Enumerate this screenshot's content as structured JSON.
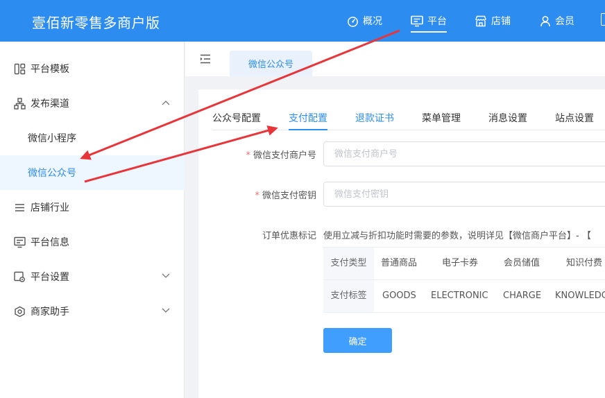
{
  "header": {
    "brand": "壹佰新零售多商户版",
    "nav": [
      {
        "label": "概况",
        "icon": "dashboard-icon"
      },
      {
        "label": "平台",
        "icon": "monitor-icon",
        "active": true
      },
      {
        "label": "店铺",
        "icon": "store-icon"
      },
      {
        "label": "会员",
        "icon": "user-icon"
      }
    ]
  },
  "sidebar": {
    "items": [
      {
        "label": "平台模板",
        "icon": "template-icon"
      },
      {
        "label": "发布渠道",
        "icon": "channel-icon",
        "expanded": true
      },
      {
        "label": "微信小程序"
      },
      {
        "label": "微信公众号",
        "selected": true
      },
      {
        "label": "店铺行业",
        "icon": "list-icon"
      },
      {
        "label": "平台信息",
        "icon": "monitor-icon"
      },
      {
        "label": "平台设置",
        "icon": "settings-icon"
      },
      {
        "label": "商家助手",
        "icon": "helper-icon"
      }
    ]
  },
  "page_tab": {
    "label": "微信公众号"
  },
  "tabs": [
    {
      "label": "公众号配置"
    },
    {
      "label": "支付配置",
      "active": true
    },
    {
      "label": "退款证书",
      "link": true
    },
    {
      "label": "菜单管理"
    },
    {
      "label": "消息设置"
    },
    {
      "label": "站点设置"
    }
  ],
  "form": {
    "merchant_id": {
      "label": "微信支付商户号",
      "placeholder": "微信支付商户号",
      "required": "*"
    },
    "pay_key": {
      "label": "微信支付密钥",
      "placeholder": "微信支付密钥",
      "required": "*"
    },
    "discount_tag": {
      "label": "订单优惠标记",
      "hint": "使用立减与折扣功能时需要的参数，说明详见【微信商户平台】- 【",
      "table": {
        "type_header": "支付类型",
        "tag_header": "支付标签",
        "types": [
          "普通商品",
          "电子卡券",
          "会员储值",
          "知识付费"
        ],
        "tags": [
          "GOODS",
          "ELECTRONIC",
          "CHARGE",
          "KNOWLEDGE"
        ]
      }
    },
    "confirm_label": "确定"
  },
  "colors": {
    "primary": "#2d8cf0",
    "button": "#409eff",
    "arrow": "#e8353a"
  }
}
